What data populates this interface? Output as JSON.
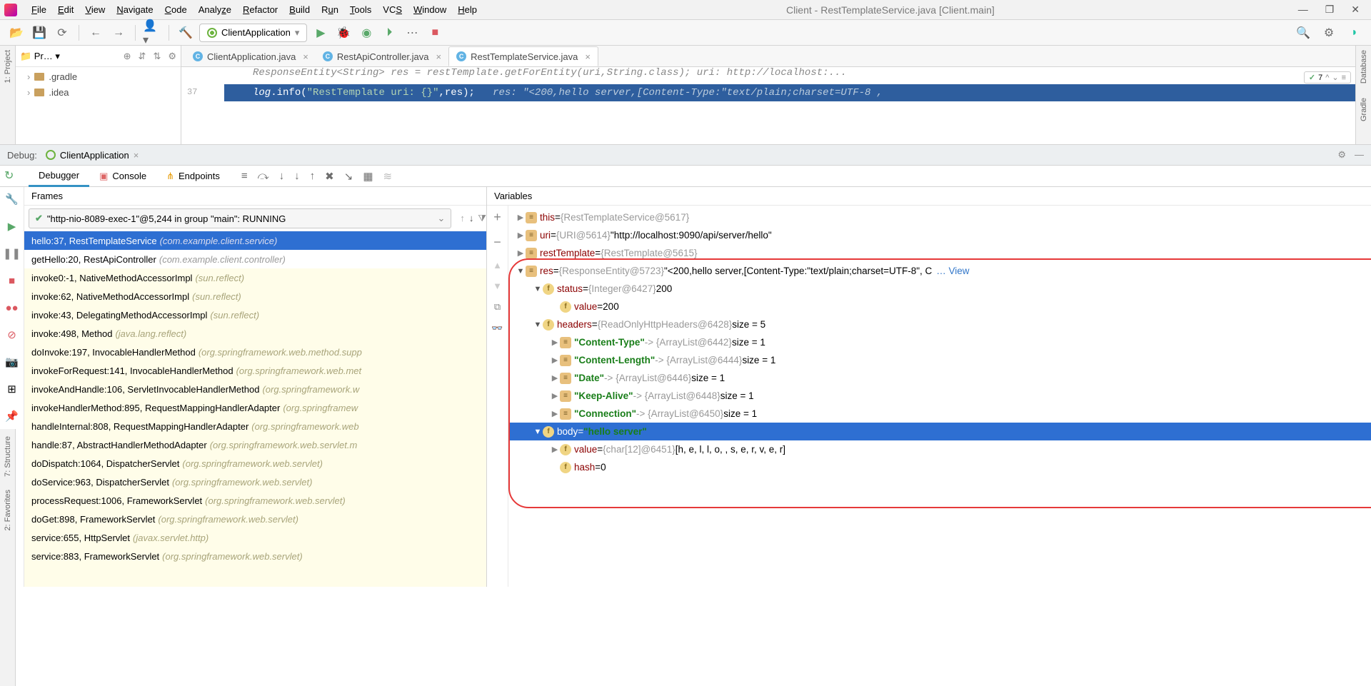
{
  "window": {
    "title": "Client - RestTemplateService.java [Client.main]"
  },
  "menu": [
    "File",
    "Edit",
    "View",
    "Navigate",
    "Code",
    "Analyze",
    "Refactor",
    "Build",
    "Run",
    "Tools",
    "VCS",
    "Window",
    "Help"
  ],
  "runConfig": "ClientApplication",
  "projectTree": {
    "items": [
      ".gradle",
      ".idea"
    ]
  },
  "editorTabs": [
    {
      "label": "ClientApplication.java",
      "active": false
    },
    {
      "label": "RestApiController.java",
      "active": false
    },
    {
      "label": "RestTemplateService.java",
      "active": true
    }
  ],
  "editor": {
    "lineNo": "37",
    "codeTop": "ResponseEntity<String> res = restTemplate.getForEntity(uri,String.class);   uri:  http://localhost:...",
    "code": "log.info(\"RestTemplate uri: {}\",res);",
    "inlineHint": "res: \"<200,hello server,[Content-Type:\"text/plain;charset=UTF-8 ,",
    "warnCount": "7"
  },
  "debugBar": {
    "label": "Debug:",
    "app": "ClientApplication"
  },
  "debuggerTabs": {
    "debugger": "Debugger",
    "console": "Console",
    "endpoints": "Endpoints"
  },
  "frames": {
    "header": "Frames",
    "thread": "\"http-nio-8089-exec-1\"@5,244 in group \"main\": RUNNING",
    "list": [
      {
        "m": "hello:37, RestTemplateService",
        "p": "(com.example.client.service)",
        "sel": true,
        "white": false
      },
      {
        "m": "getHello:20, RestApiController",
        "p": "(com.example.client.controller)",
        "sel": false,
        "white": true
      },
      {
        "m": "invoke0:-1, NativeMethodAccessorImpl",
        "p": "(sun.reflect)",
        "sel": false,
        "white": false
      },
      {
        "m": "invoke:62, NativeMethodAccessorImpl",
        "p": "(sun.reflect)",
        "sel": false,
        "white": false
      },
      {
        "m": "invoke:43, DelegatingMethodAccessorImpl",
        "p": "(sun.reflect)",
        "sel": false,
        "white": false
      },
      {
        "m": "invoke:498, Method",
        "p": "(java.lang.reflect)",
        "sel": false,
        "white": false
      },
      {
        "m": "doInvoke:197, InvocableHandlerMethod",
        "p": "(org.springframework.web.method.supp",
        "sel": false,
        "white": false
      },
      {
        "m": "invokeForRequest:141, InvocableHandlerMethod",
        "p": "(org.springframework.web.met",
        "sel": false,
        "white": false
      },
      {
        "m": "invokeAndHandle:106, ServletInvocableHandlerMethod",
        "p": "(org.springframework.w",
        "sel": false,
        "white": false
      },
      {
        "m": "invokeHandlerMethod:895, RequestMappingHandlerAdapter",
        "p": "(org.springframew",
        "sel": false,
        "white": false
      },
      {
        "m": "handleInternal:808, RequestMappingHandlerAdapter",
        "p": "(org.springframework.web",
        "sel": false,
        "white": false
      },
      {
        "m": "handle:87, AbstractHandlerMethodAdapter",
        "p": "(org.springframework.web.servlet.m",
        "sel": false,
        "white": false
      },
      {
        "m": "doDispatch:1064, DispatcherServlet",
        "p": "(org.springframework.web.servlet)",
        "sel": false,
        "white": false
      },
      {
        "m": "doService:963, DispatcherServlet",
        "p": "(org.springframework.web.servlet)",
        "sel": false,
        "white": false
      },
      {
        "m": "processRequest:1006, FrameworkServlet",
        "p": "(org.springframework.web.servlet)",
        "sel": false,
        "white": false
      },
      {
        "m": "doGet:898, FrameworkServlet",
        "p": "(org.springframework.web.servlet)",
        "sel": false,
        "white": false
      },
      {
        "m": "service:655, HttpServlet",
        "p": "(javax.servlet.http)",
        "sel": false,
        "white": false
      },
      {
        "m": "service:883, FrameworkServlet",
        "p": "(org.springframework.web.servlet)",
        "sel": false,
        "white": false
      }
    ]
  },
  "vars": {
    "header": "Variables",
    "root": [
      {
        "ind": 0,
        "arr": "r",
        "ic": "p",
        "n": "this",
        "eq": " = ",
        "t": "{RestTemplateService@5617}"
      },
      {
        "ind": 0,
        "arr": "r",
        "ic": "p",
        "n": "uri",
        "eq": " = ",
        "t": "{URI@5614}",
        "v": " \"http://localhost:9090/api/server/hello\""
      },
      {
        "ind": 0,
        "arr": "r",
        "ic": "p",
        "n": "restTemplate",
        "eq": " = ",
        "t": "{RestTemplate@5615}"
      },
      {
        "ind": 0,
        "arr": "d",
        "ic": "p",
        "n": "res",
        "eq": " = ",
        "t": "{ResponseEntity@5723}",
        "v": " \"<200,hello server,[Content-Type:\"text/plain;charset=UTF-8\", C",
        "view": "…  View"
      },
      {
        "ind": 1,
        "arr": "d",
        "ic": "f",
        "n": "status",
        "eq": " = ",
        "t": "{Integer@6427}",
        "v": " 200"
      },
      {
        "ind": 2,
        "arr": "",
        "ic": "f",
        "n": "value",
        "eq": " = ",
        "v": "200"
      },
      {
        "ind": 1,
        "arr": "d",
        "ic": "f",
        "n": "headers",
        "eq": " = ",
        "t": "{ReadOnlyHttpHeaders@6428}",
        "v": "  size = 5"
      },
      {
        "ind": 2,
        "arr": "r",
        "ic": "p",
        "s": "\"Content-Type\"",
        "t2": " -> {ArrayList@6442}",
        "v": "  size = 1"
      },
      {
        "ind": 2,
        "arr": "r",
        "ic": "p",
        "s": "\"Content-Length\"",
        "t2": " -> {ArrayList@6444}",
        "v": "  size = 1"
      },
      {
        "ind": 2,
        "arr": "r",
        "ic": "p",
        "s": "\"Date\"",
        "t2": " -> {ArrayList@6446}",
        "v": "  size = 1"
      },
      {
        "ind": 2,
        "arr": "r",
        "ic": "p",
        "s": "\"Keep-Alive\"",
        "t2": " -> {ArrayList@6448}",
        "v": "  size = 1"
      },
      {
        "ind": 2,
        "arr": "r",
        "ic": "p",
        "s": "\"Connection\"",
        "t2": " -> {ArrayList@6450}",
        "v": "  size = 1"
      },
      {
        "ind": 1,
        "arr": "d",
        "ic": "f",
        "n": "body",
        "eq": " = ",
        "s2": "\"hello server\"",
        "sel": true
      },
      {
        "ind": 2,
        "arr": "r",
        "ic": "f",
        "n": "value",
        "eq": " = ",
        "t": "{char[12]@6451}",
        "v": " [h, e, l, l, o,  , s, e, r, v, e, r]"
      },
      {
        "ind": 2,
        "arr": "",
        "ic": "f",
        "n": "hash",
        "eq": " = ",
        "v": "0"
      }
    ]
  },
  "leftStrip": {
    "project": "1: Project",
    "structure": "7: Structure",
    "favorites": "2: Favorites"
  },
  "rightStrip": {
    "database": "Database",
    "gradle": "Gradle"
  }
}
